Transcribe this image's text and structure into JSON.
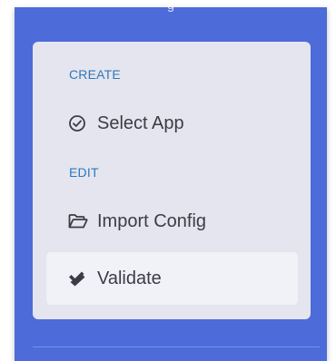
{
  "panel": {
    "top_fragment": "g"
  },
  "menu": {
    "sections": [
      {
        "heading": "CREATE"
      },
      {
        "heading": "EDIT"
      }
    ],
    "items": [
      {
        "label": "Select App",
        "icon": "check-circle-icon"
      },
      {
        "label": "Import Config",
        "icon": "folder-open-icon"
      },
      {
        "label": "Validate",
        "icon": "double-check-icon"
      }
    ]
  },
  "colors": {
    "panel": "#4d6bd9",
    "card": "#e4e5ee",
    "active_item": "#f1f2f7",
    "heading": "#2f78bb",
    "text": "#3b3d45"
  }
}
